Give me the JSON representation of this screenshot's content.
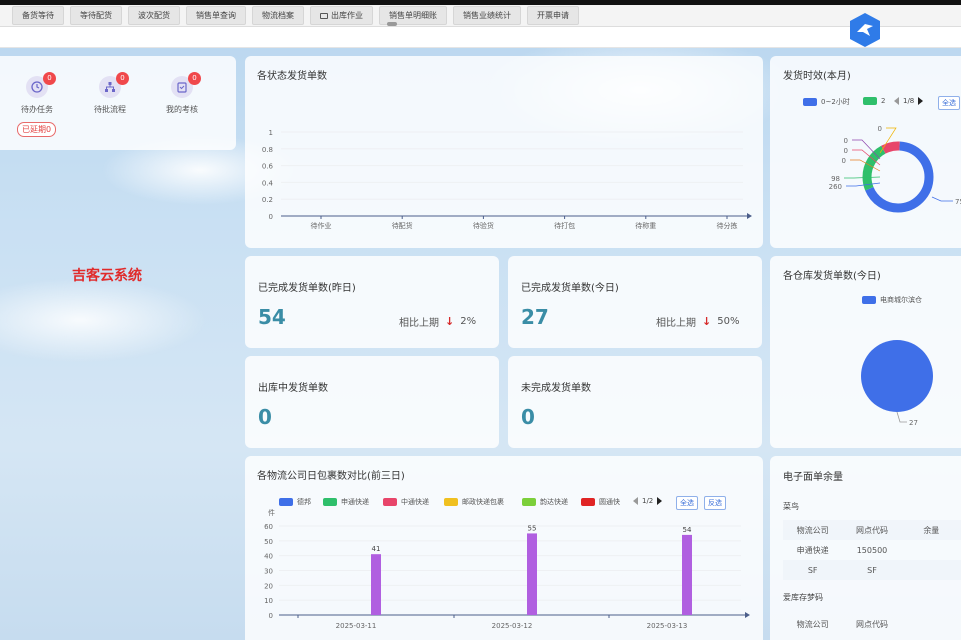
{
  "tabs": [
    {
      "label": "备货等待",
      "icon": ""
    },
    {
      "label": "等待配货",
      "icon": ""
    },
    {
      "label": "波次配货",
      "icon": ""
    },
    {
      "label": "销售单查询",
      "icon": ""
    },
    {
      "label": "物流档案",
      "icon": ""
    },
    {
      "label": "出库作业",
      "icon": "folder-icon"
    },
    {
      "label": "销售单明细账",
      "icon": ""
    },
    {
      "label": "销售业绩统计",
      "icon": ""
    },
    {
      "label": "开票申请",
      "icon": ""
    }
  ],
  "quick": {
    "todo": {
      "label": "待办任务",
      "badge": "0"
    },
    "approval": {
      "label": "待批流程",
      "badge": "0"
    },
    "review": {
      "label": "我的考核",
      "badge": "0"
    },
    "overdue": "已延期0"
  },
  "brand": "吉客云系统",
  "status_chart": {
    "title": "各状态发货单数"
  },
  "yesterday": {
    "title": "已完成发货单数(昨日)",
    "value": "54",
    "compare_label": "相比上期",
    "change": "2%"
  },
  "today": {
    "title": "已完成发货单数(今日)",
    "value": "27",
    "compare_label": "相比上期",
    "change": "50%"
  },
  "outbound": {
    "title": "出库中发货单数",
    "value": "0"
  },
  "unfinished": {
    "title": "未完成发货单数",
    "value": "0"
  },
  "timeliness": {
    "title": "发货时效(本月)",
    "legend": [
      "0~2小时",
      "2"
    ],
    "pager": "1/8",
    "select_all": "全选"
  },
  "warehouse": {
    "title": "各仓库发货单数(今日)",
    "legend": "电商城尔滨仓"
  },
  "logistics": {
    "title": "各物流公司日包裹数对比(前三日)",
    "unit": "件",
    "pager": "1/2",
    "select_all": "全选",
    "invert": "反选"
  },
  "waybill": {
    "title": "电子面单余量",
    "section1": "菜鸟",
    "section2": "爱库存梦码",
    "columns": [
      "物流公司",
      "网点代码",
      "余量"
    ],
    "rows": [
      [
        "申通快递",
        "150500",
        ""
      ],
      [
        "SF",
        "SF",
        ""
      ]
    ],
    "columns2": [
      "物流公司",
      "网点代码",
      ""
    ]
  },
  "colors": {
    "accent": "#3f6fe8",
    "value": "#3a8da6",
    "bar": "#b05fe0",
    "badge": "#f0484b"
  },
  "chart_data": [
    {
      "type": "line",
      "title": "各状态发货单数",
      "categories": [
        "待作业",
        "待配货",
        "待验货",
        "待打包",
        "待称重",
        "待分拣"
      ],
      "values": [
        0,
        0,
        0,
        0,
        0,
        0
      ],
      "ylim": [
        0,
        1
      ],
      "yticks": [
        "1",
        "0.8",
        "0.6",
        "0.4",
        "0.2",
        "0"
      ]
    },
    {
      "type": "pie",
      "title": "发货时效(本月)",
      "labels": [
        "0~2小时",
        "2"
      ],
      "values": [
        757,
        260,
        98,
        0,
        0,
        0,
        0
      ],
      "value_labels": [
        "75",
        "260",
        "98",
        "0",
        "0",
        "0",
        "0"
      ],
      "colors": [
        "#3f6fe8",
        "#2fbf6b",
        "#e8456a",
        "#f0b400",
        "#8e44ad",
        "#e67e22",
        "#1abc9c"
      ]
    },
    {
      "type": "pie",
      "title": "各仓库发货单数(今日)",
      "labels": [
        "电商城尔滨仓"
      ],
      "values": [
        27
      ],
      "value_labels": [
        "27"
      ],
      "colors": [
        "#3f6fe8"
      ]
    },
    {
      "type": "bar",
      "title": "各物流公司日包裹数对比(前三日)",
      "categories": [
        "2025-03-11",
        "2025-03-12",
        "2025-03-13"
      ],
      "series": [
        {
          "name": "德邦",
          "color": "#3f6fe8",
          "values": [
            0,
            0,
            0
          ]
        },
        {
          "name": "申通快递",
          "color": "#2fbf6b",
          "values": [
            0,
            0,
            0
          ]
        },
        {
          "name": "中通快递",
          "color": "#e8456a",
          "values": [
            0,
            0,
            0
          ]
        },
        {
          "name": "邮政快递包裹",
          "color": "#f0c020",
          "values": [
            0,
            0,
            0
          ]
        },
        {
          "name": "韵达快递",
          "color": "#7ccf3a",
          "values": [
            0,
            0,
            0
          ]
        },
        {
          "name": "圆通快",
          "color": "#e02424",
          "values": [
            0,
            0,
            0
          ]
        },
        {
          "name": "",
          "color": "#b05fe0",
          "values": [
            41,
            55,
            54
          ]
        }
      ],
      "ylim": [
        0,
        60
      ],
      "yticks": [
        "60",
        "50",
        "40",
        "30",
        "20",
        "10",
        "0"
      ]
    }
  ]
}
